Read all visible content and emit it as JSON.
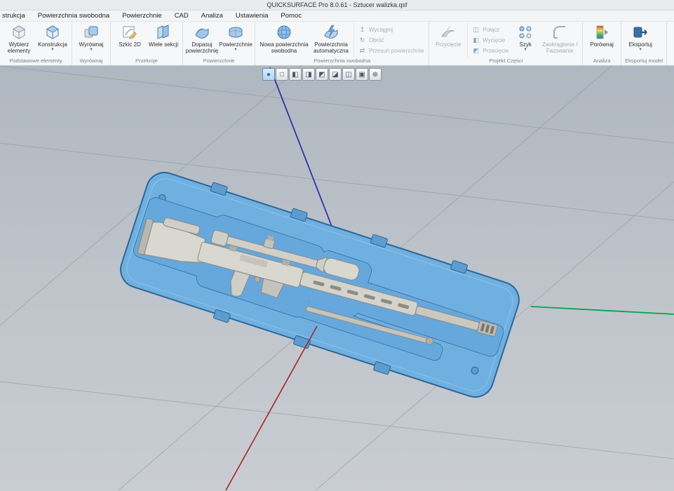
{
  "window": {
    "title": "QUICKSURFACE Pro 8.0.61 - Sztucer walizka.qsf"
  },
  "menubar": {
    "items": [
      "strukcja",
      "Powierzchnia swobodna",
      "Powierzchnie",
      "CAD",
      "Analiza",
      "Ustawienia",
      "Pomoc"
    ]
  },
  "ribbon": {
    "groups": [
      {
        "label": "Podstawowe elementy",
        "buttons": [
          {
            "label": "Wybierz elementy"
          },
          {
            "label": "Konstrukcja",
            "caret": "▾"
          }
        ]
      },
      {
        "label": "Wyrównaj",
        "buttons": [
          {
            "label": "Wyrównaj",
            "caret": "▾"
          }
        ]
      },
      {
        "label": "Przekroje",
        "buttons": [
          {
            "label": "Szkic 2D"
          },
          {
            "label": "Wiele sekcji"
          }
        ]
      },
      {
        "label": "Powierzchnie",
        "buttons": [
          {
            "label": "Dopasuj powierzchnię"
          },
          {
            "label": "Powierzchnie",
            "caret": "▾"
          }
        ]
      },
      {
        "label": "Powierzchnia swobodna",
        "buttons": [
          {
            "label": "Nowa powierzchnia swobodna"
          },
          {
            "label": "Powierzchnia automatyczna"
          }
        ],
        "small_buttons": [
          {
            "label": "Wyciągnij",
            "glyph": "↥"
          },
          {
            "label": "Obróć",
            "glyph": "↻"
          },
          {
            "label": "Przesuń powierzchnie",
            "glyph": "⇄"
          }
        ]
      },
      {
        "label": "Projekt Części",
        "buttons": [
          {
            "label": "Przycięcie"
          },
          {
            "label": "Szyk",
            "caret": "▾"
          },
          {
            "label": "Zaokrąglenie / Fazowanie"
          }
        ],
        "small_buttons": [
          {
            "label": "Połącz",
            "glyph": "◫"
          },
          {
            "label": "Wycięcie",
            "glyph": "◧"
          },
          {
            "label": "Przecięcie",
            "glyph": "◩"
          }
        ]
      },
      {
        "label": "Analiza",
        "buttons": [
          {
            "label": "Porównaj"
          }
        ]
      },
      {
        "label": "Eksportuj model",
        "buttons": [
          {
            "label": "Eksportuj",
            "caret": "▾"
          }
        ]
      }
    ]
  },
  "view_toolbar": {
    "buttons": [
      {
        "name": "shaded-view",
        "glyph": "●"
      },
      {
        "name": "wireframe-view",
        "glyph": "□"
      },
      {
        "name": "front-view",
        "glyph": "◧"
      },
      {
        "name": "back-view",
        "glyph": "◨"
      },
      {
        "name": "left-view",
        "glyph": "◩"
      },
      {
        "name": "right-view",
        "glyph": "◪"
      },
      {
        "name": "top-view",
        "glyph": "◫"
      },
      {
        "name": "iso-view",
        "glyph": "▣"
      },
      {
        "name": "orient-axis",
        "glyph": "⊕"
      }
    ]
  },
  "viewport": {
    "axis_colors": {
      "x": "#a32626",
      "y": "#00a651",
      "z": "#2323a8"
    },
    "model_colors": {
      "case": "#6fb0e0",
      "case_outline": "#2b6698",
      "rifle": "#d8d7d0"
    }
  }
}
